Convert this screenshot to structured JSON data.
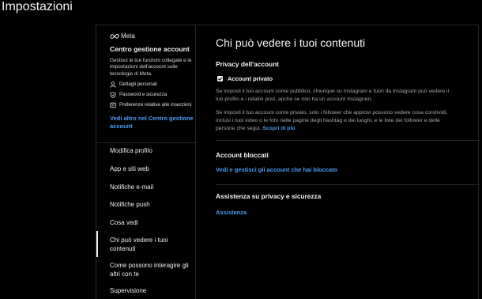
{
  "page": {
    "title": "Impostazioni"
  },
  "accounts_center": {
    "logo_text": "Meta",
    "title": "Centro gestione account",
    "description": "Gestisci le tue funzioni collegate e le impostazioni dell'account sulle tecnologie di Meta.",
    "items": [
      {
        "icon": "person-icon",
        "label": "Dettagli personali"
      },
      {
        "icon": "shield-icon",
        "label": "Password e sicurezza"
      },
      {
        "icon": "ad-icon",
        "label": "Preferenze relative alle inserzioni"
      }
    ],
    "link": "Vedi altro nel Centro gestione account"
  },
  "nav": {
    "items": [
      {
        "label": "Modifica profilo"
      },
      {
        "label": "App e siti web"
      },
      {
        "label": "Notifiche e-mail"
      },
      {
        "label": "Notifiche push"
      },
      {
        "label": "Cosa vedi"
      },
      {
        "label": "Chi può vedere i tuoi contenuti",
        "active": true
      },
      {
        "label": "Come possono interagire gli altri con te"
      },
      {
        "label": "Supervisione"
      }
    ]
  },
  "content": {
    "title": "Chi può vedere i tuoi contenuti",
    "privacy": {
      "heading": "Privacy dell'account",
      "checkbox_label": "Account privato",
      "checked": true,
      "paragraph1": "Se imposti il tuo account come pubblico, chiunque su Instagram e fuori da Instagram può vedere il tuo profilo e i relativi post, anche se non ha un account Instagram.",
      "paragraph2": "Se imposti il tuo account come privato, solo i follower che approvi possono vedere cosa condividi, inclusi i tuoi video o le foto nelle pagine degli hashtag e dei luoghi, e le liste dei follower e delle persone che segui.",
      "learn_more": "Scopri di più"
    },
    "blocked": {
      "heading": "Account bloccati",
      "link": "Vedi e gestisci gli account che hai bloccato"
    },
    "help": {
      "heading": "Assistenza su privacy e sicurezza",
      "link": "Assistenza"
    }
  },
  "colors": {
    "background": "#000000",
    "link": "#4a9cf5",
    "divider": "#262626",
    "muted_text": "#a8a8a8"
  }
}
